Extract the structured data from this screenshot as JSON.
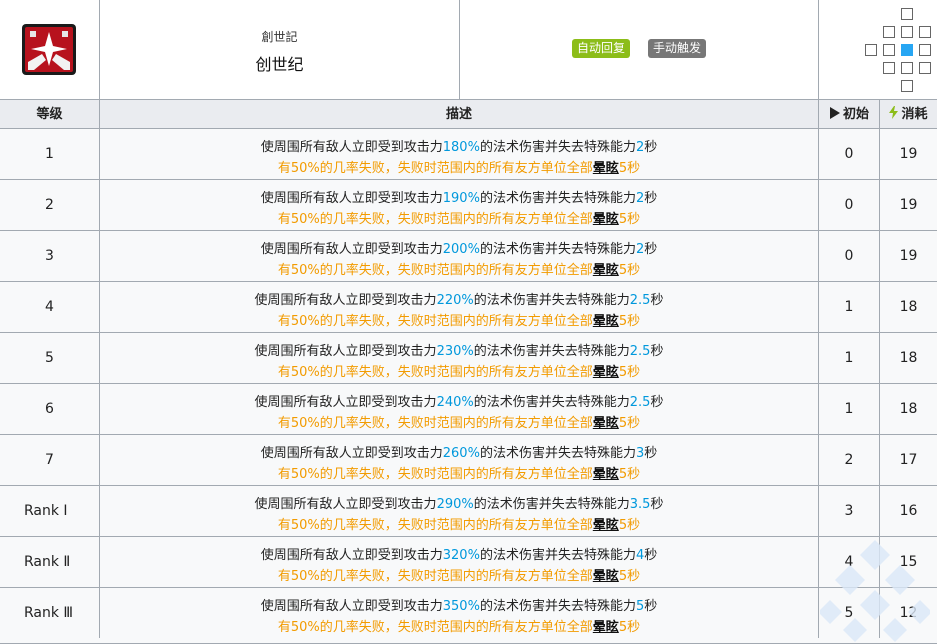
{
  "skill": {
    "name_jp": "創世記",
    "name_cn": "创世纪",
    "recovery_tag": "自动回复",
    "trigger_tag": "手动触发",
    "tag_colors": {
      "auto": "#8cbd19",
      "manual": "#777777"
    },
    "range_highlight_color": "#27a6f3"
  },
  "table": {
    "headers": {
      "level": "等级",
      "description": "描述",
      "initial": "初始",
      "cost": "消耗"
    },
    "desc_line2": {
      "prefix": "有50%的几率失败，失败时范围内的所有友方单位全部",
      "keyword": "晕眩",
      "suffix": "5秒"
    },
    "rows": [
      {
        "level": "1",
        "pre": "使周围所有敌人立即受到攻击力",
        "atk": "180%",
        "mid": "的法术伤害并失去特殊能力",
        "dur": "2",
        "post": "秒",
        "initial": "0",
        "cost": "19"
      },
      {
        "level": "2",
        "pre": "使周围所有敌人立即受到攻击力",
        "atk": "190%",
        "mid": "的法术伤害并失去特殊能力",
        "dur": "2",
        "post": "秒",
        "initial": "0",
        "cost": "19"
      },
      {
        "level": "3",
        "pre": "使周围所有敌人立即受到攻击力",
        "atk": "200%",
        "mid": "的法术伤害并失去特殊能力",
        "dur": "2",
        "post": "秒",
        "initial": "0",
        "cost": "19"
      },
      {
        "level": "4",
        "pre": "使周围所有敌人立即受到攻击力",
        "atk": "220%",
        "mid": "的法术伤害并失去特殊能力",
        "dur": "2.5",
        "post": "秒",
        "initial": "1",
        "cost": "18"
      },
      {
        "level": "5",
        "pre": "使周围所有敌人立即受到攻击力",
        "atk": "230%",
        "mid": "的法术伤害并失去特殊能力",
        "dur": "2.5",
        "post": "秒",
        "initial": "1",
        "cost": "18"
      },
      {
        "level": "6",
        "pre": "使周围所有敌人立即受到攻击力",
        "atk": "240%",
        "mid": "的法术伤害并失去特殊能力",
        "dur": "2.5",
        "post": "秒",
        "initial": "1",
        "cost": "18"
      },
      {
        "level": "7",
        "pre": "使周围所有敌人立即受到攻击力",
        "atk": "260%",
        "mid": "的法术伤害并失去特殊能力",
        "dur": "3",
        "post": "秒",
        "initial": "2",
        "cost": "17"
      },
      {
        "level": "Rank Ⅰ",
        "pre": "使周围所有敌人立即受到攻击力",
        "atk": "290%",
        "mid": "的法术伤害并失去特殊能力",
        "dur": "3.5",
        "post": "秒",
        "initial": "3",
        "cost": "16"
      },
      {
        "level": "Rank Ⅱ",
        "pre": "使周围所有敌人立即受到攻击力",
        "atk": "320%",
        "mid": "的法术伤害并失去特殊能力",
        "dur": "4",
        "post": "秒",
        "initial": "4",
        "cost": "15"
      },
      {
        "level": "Rank Ⅲ",
        "pre": "使周围所有敌人立即受到攻击力",
        "atk": "350%",
        "mid": "的法术伤害并失去特殊能力",
        "dur": "5",
        "post": "秒",
        "initial": "5",
        "cost": "12"
      }
    ]
  },
  "colors": {
    "highlight_value": "#0098dc",
    "penalty_text": "#f29b00",
    "header_bg": "#eaecf0",
    "row_bg": "#f8f9fa",
    "border": "#a2a9b1"
  }
}
